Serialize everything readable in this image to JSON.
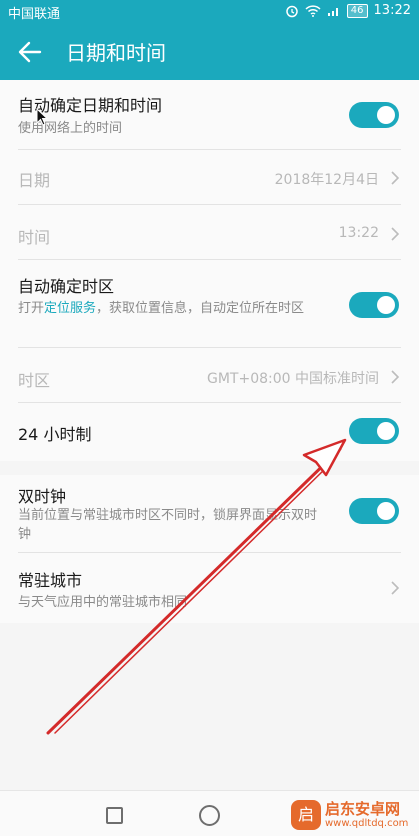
{
  "status_bar": {
    "carrier": "中国联通",
    "battery": "46",
    "time": "13:22"
  },
  "header": {
    "title": "日期和时间"
  },
  "rows": {
    "auto_datetime": {
      "title": "自动确定日期和时间",
      "subtitle": "使用网络上的时间",
      "toggle_on": true
    },
    "date": {
      "title": "日期",
      "value": "2018年12月4日"
    },
    "time": {
      "title": "时间",
      "value": "13:22"
    },
    "auto_timezone": {
      "title": "自动确定时区",
      "subtitle_prefix": "打开",
      "subtitle_link": "定位服务",
      "subtitle_suffix": "，获取位置信息，自动定位所在时区",
      "toggle_on": true
    },
    "timezone": {
      "title": "时区",
      "value": "GMT+08:00 中国标准时间"
    },
    "hour24": {
      "title": "24 小时制",
      "toggle_on": true
    },
    "dual_clock": {
      "title": "双时钟",
      "subtitle": "当前位置与常驻城市时区不同时，锁屏界面显示双时钟",
      "toggle_on": true
    },
    "home_city": {
      "title": "常驻城市",
      "subtitle": "与天气应用中的常驻城市相同"
    }
  },
  "watermark": {
    "name": "启东安卓网",
    "url": "www.qdltdq.com",
    "logo_char": "启"
  },
  "colors": {
    "accent": "#1ba9bd",
    "annotation": "#d42a2a"
  }
}
